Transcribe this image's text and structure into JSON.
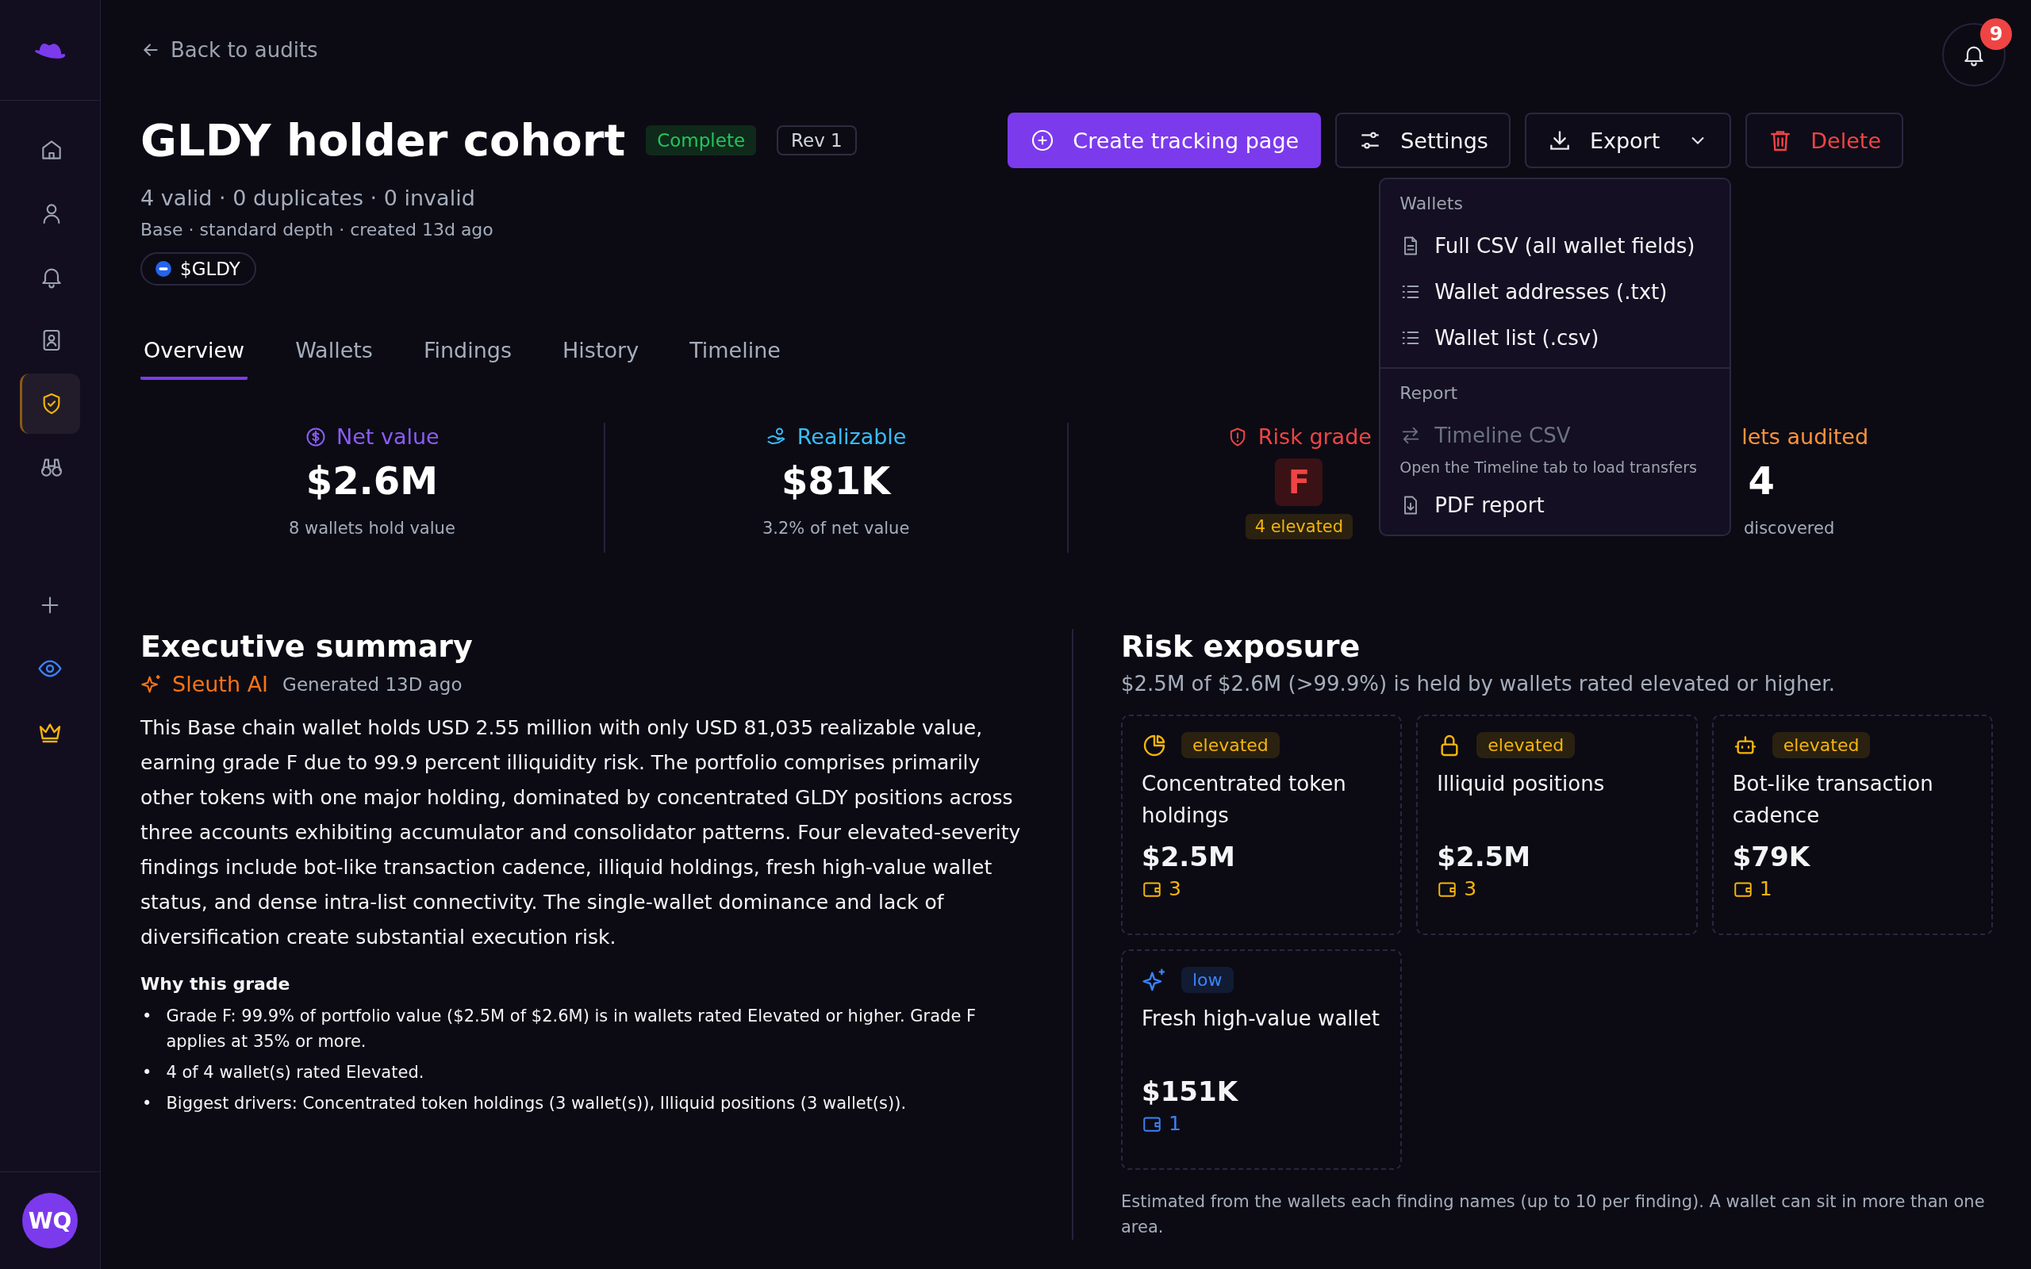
{
  "sidebar": {
    "nav": [
      {
        "selected": false
      },
      {
        "selected": false
      },
      {
        "selected": false
      },
      {
        "selected": false
      },
      {
        "selected": true
      },
      {
        "selected": false
      }
    ],
    "avatar": "WQ"
  },
  "notifications": {
    "count": "9"
  },
  "back_link": "Back to audits",
  "header": {
    "title": "GLDY holder cohort",
    "status": "Complete",
    "revision": "Rev 1",
    "counts": "4 valid · 0 duplicates · 0 invalid",
    "meta": "Base · standard depth · created 13d ago",
    "token": "$GLDY"
  },
  "actions": {
    "create": "Create tracking page",
    "settings": "Settings",
    "export": "Export",
    "delete": "Delete"
  },
  "export_menu": {
    "sections": [
      {
        "title": "Wallets",
        "items": [
          {
            "label": "Full CSV (all wallet fields)",
            "disabled": false
          },
          {
            "label": "Wallet addresses (.txt)",
            "disabled": false
          },
          {
            "label": "Wallet list (.csv)",
            "disabled": false
          }
        ]
      },
      {
        "title": "Report",
        "items": [
          {
            "label": "Timeline CSV",
            "disabled": true,
            "hint": "Open the Timeline tab to load transfers"
          },
          {
            "label": "PDF report",
            "disabled": false
          }
        ]
      }
    ]
  },
  "tabs": [
    {
      "label": "Overview",
      "selected": true
    },
    {
      "label": "Wallets",
      "selected": false
    },
    {
      "label": "Findings",
      "selected": false
    },
    {
      "label": "History",
      "selected": false
    },
    {
      "label": "Timeline",
      "selected": false
    }
  ],
  "stats": [
    {
      "kind": "plain",
      "label": "Net value",
      "color": "#8b5cf6",
      "value": "$2.6M",
      "caption": "8 wallets hold value"
    },
    {
      "kind": "plain",
      "label": "Realizable",
      "color": "#38bdf8",
      "value": "$81K",
      "caption": "3.2% of net value"
    },
    {
      "kind": "grade",
      "label": "Risk grade",
      "color": "#ef4444",
      "value": "F",
      "caption": "4 elevated"
    },
    {
      "kind": "partial",
      "label": "lets audited",
      "color": "#fb923c",
      "value": "4",
      "caption": "discovered"
    }
  ],
  "summary": {
    "title": "Executive summary",
    "source": "Sleuth AI",
    "generated": "Generated 13D ago",
    "body": "This Base chain wallet holds USD 2.55 million with only USD 81,035 realizable value, earning grade F due to 99.9 percent illiquidity risk. The portfolio comprises primarily other tokens with one major holding, dominated by concentrated GLDY positions across three accounts exhibiting accumulator and consolidator patterns. Four elevated-severity findings include bot-like transaction cadence, illiquid holdings, fresh high-value wallet status, and dense intra-list connectivity. The single-wallet dominance and lack of diversification create substantial execution risk.",
    "why_title": "Why this grade",
    "bullet": "•",
    "reasons": [
      "Grade F: 99.9% of portfolio value ($2.5M of $2.6M) is in wallets rated Elevated or higher. Grade F applies at 35% or more.",
      "4 of 4 wallet(s) rated Elevated.",
      "Biggest drivers: Concentrated token holdings (3 wallet(s)), Illiquid positions (3 wallet(s))."
    ]
  },
  "risk": {
    "title": "Risk exposure",
    "subtitle": "$2.5M of $2.6M (>99.9%) is held by wallets rated elevated or higher.",
    "cards": [
      {
        "severity": "elevated",
        "title": "Concentrated token holdings",
        "value": "$2.5M",
        "wallets": "3"
      },
      {
        "severity": "elevated",
        "title": "Illiquid positions",
        "value": "$2.5M",
        "wallets": "3"
      },
      {
        "severity": "elevated",
        "title": "Bot-like transaction cadence",
        "value": "$79K",
        "wallets": "1"
      },
      {
        "severity": "low",
        "title": "Fresh high-value wallet",
        "value": "$151K",
        "wallets": "1"
      }
    ],
    "footnote": "Estimated from the wallets each finding names (up to 10 per finding). A wallet can sit in more than one area."
  }
}
